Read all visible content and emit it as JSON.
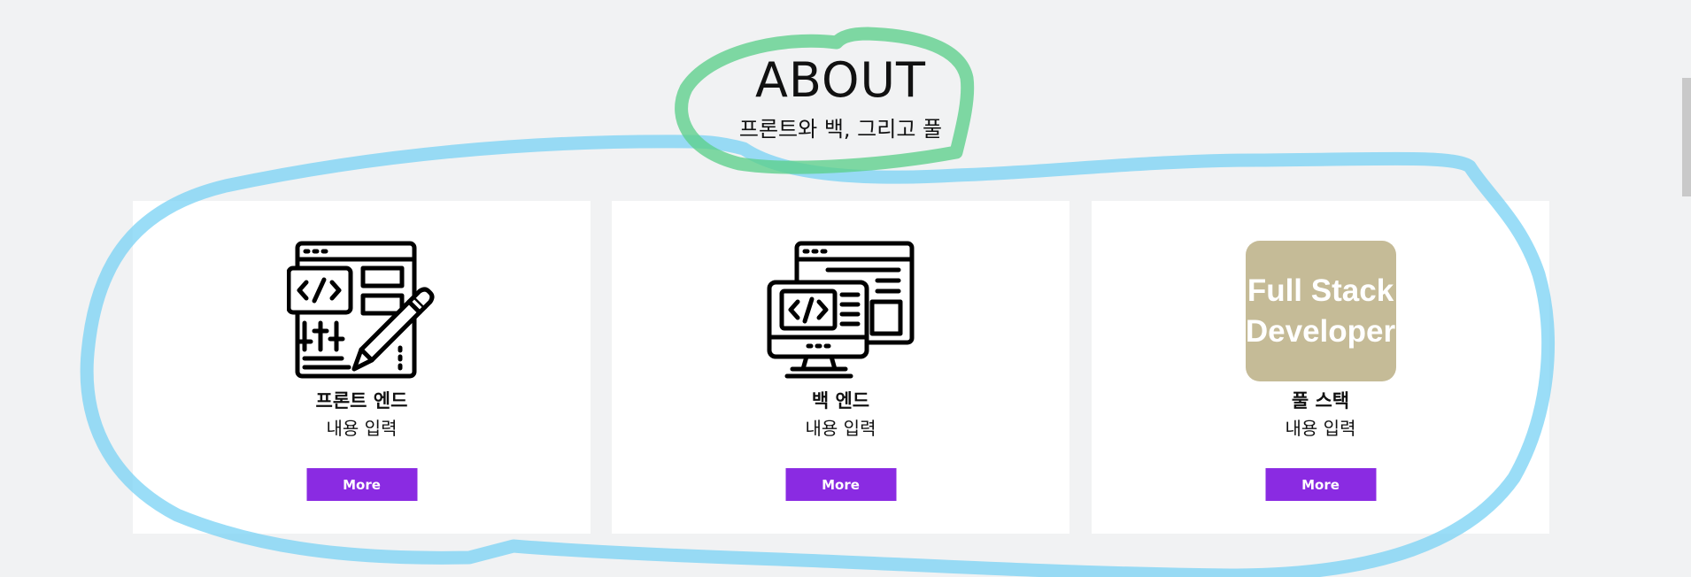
{
  "about": {
    "title": "ABOUT",
    "subtitle": "프론트와 백, 그리고 풀"
  },
  "cards": [
    {
      "icon": "frontend-design-icon",
      "title": "프론트 엔드",
      "text": "내용 입력",
      "button_label": "More"
    },
    {
      "icon": "backend-computer-code-icon",
      "title": "백 엔드",
      "text": "내용 입력",
      "button_label": "More"
    },
    {
      "icon": "full-stack-developer-badge",
      "badge_text": "Full Stack Developer",
      "badge_line1": "Full Stack",
      "badge_line2": "Developer",
      "title": "풀 스택",
      "text": "내용 입력",
      "button_label": "More"
    }
  ],
  "colors": {
    "background": "#f1f2f3",
    "card": "#ffffff",
    "button": "#8a2be2",
    "badge": "#c5bb97",
    "annotation_green": "#5ccf8a",
    "annotation_blue": "#78d2f4"
  }
}
